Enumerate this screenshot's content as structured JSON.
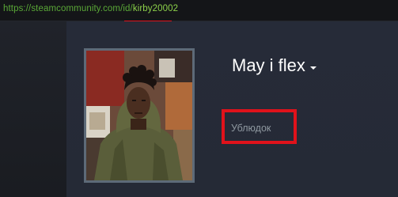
{
  "browser": {
    "url_prefix": "https://steamcommunity.com/id/",
    "url_highlight": "kirby20002",
    "highlight_color": "#e0121b"
  },
  "profile": {
    "persona_name": "May i flex",
    "real_name": "Ублюдок",
    "menu_icon": "chevron-down-icon",
    "avatar_icon": "avatar-photo"
  }
}
